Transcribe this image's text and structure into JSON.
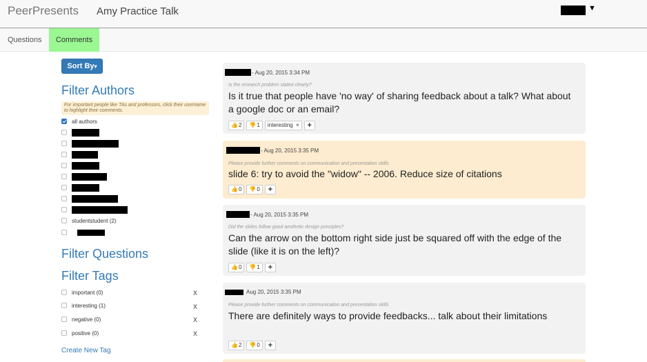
{
  "header": {
    "brand": "PeerPresents",
    "talk_title": "Amy Practice Talk"
  },
  "tabs": [
    {
      "label": "Questions"
    },
    {
      "label": "Comments"
    }
  ],
  "sidebar": {
    "sort_label": "Sort By",
    "filter_authors": "Filter Authors",
    "authors_note": "For important people like TAs and professors, click their username to highlight their comments.",
    "all_authors_label": "all authors",
    "student_label": "studentstudent (2)",
    "filter_questions": "Filter Questions",
    "filter_tags": "Filter Tags",
    "tags": [
      {
        "label": "important (0)",
        "remove": "X"
      },
      {
        "label": "interesting (1)",
        "remove": "X"
      },
      {
        "label": "negative (0)",
        "remove": "X"
      },
      {
        "label": "positive (0)",
        "remove": "X"
      }
    ],
    "create_tag": "Create New Tag"
  },
  "comments": [
    {
      "date": "- Aug 20, 2015 3:34 PM",
      "question": "Is the research problem stated clearly?",
      "text": "Is it true that people have 'no way' of sharing feedback about a talk? What about a google doc or an email?",
      "up": "2",
      "down": "1",
      "tag": "interesting",
      "tag_remove": "×",
      "add": "+"
    },
    {
      "date": "- Aug 20, 2015 3:35 PM",
      "question": "Please provide further comments on communication and presentation skills",
      "text": "slide 6: try to avoid the \"widow\" -- 2006. Reduce size of citations",
      "up": "0",
      "down": "0",
      "add": "+"
    },
    {
      "date": "- Aug 20, 2015 3:35 PM",
      "question": "Did the slides follow good aesthetic design principles?",
      "text": "Can the arrow on the bottom right side just be squared off with the edge of the slide (like it is on the left)?",
      "up": "0",
      "down": "1",
      "add": "+"
    },
    {
      "date": "Aug 20, 2015 3:35 PM",
      "question": "Please provide further comments on communication and presentation skills",
      "text": "There are definitely ways to provide feedbacks... talk about their limitations",
      "up": "2",
      "down": "0",
      "add": "+"
    }
  ],
  "icons": {
    "thumbs_up": "thumbs-up-icon",
    "thumbs_down": "thumbs-down-icon",
    "caret": "caret-down-icon"
  },
  "colors": {
    "accent": "#337ab7",
    "active_tab": "#9af792",
    "highlight_card": "#fdeccf",
    "card": "#f2f2f2"
  }
}
